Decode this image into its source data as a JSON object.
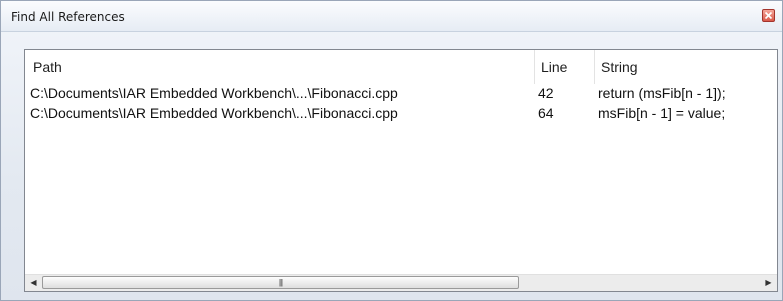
{
  "window": {
    "title": "Find All References",
    "close_icon": "close-icon"
  },
  "columns": {
    "path": "Path",
    "line": "Line",
    "string": "String"
  },
  "rows": [
    {
      "path": "C:\\Documents\\IAR Embedded Workbench\\...\\Fibonacci.cpp",
      "line": "42",
      "string": "return (msFib[n - 1]);"
    },
    {
      "path": "C:\\Documents\\IAR Embedded Workbench\\...\\Fibonacci.cpp",
      "line": "64",
      "string": "msFib[n - 1] = value;"
    }
  ],
  "scrollbar": {
    "left_arrow_icon": "left-arrow-icon",
    "right_arrow_icon": "right-arrow-icon",
    "grip_icon": "grip-icon"
  }
}
